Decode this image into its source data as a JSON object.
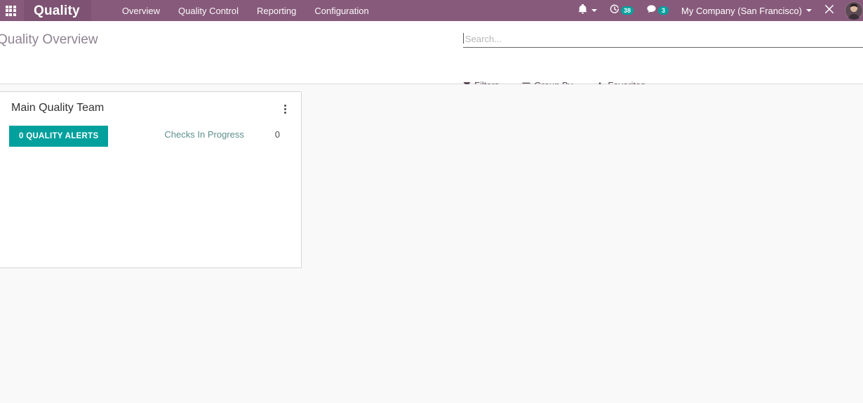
{
  "navbar": {
    "apps_icon": "apps-grid-icon",
    "brand": "Quality",
    "menu": [
      {
        "label": "Overview"
      },
      {
        "label": "Quality Control"
      },
      {
        "label": "Reporting"
      },
      {
        "label": "Configuration"
      }
    ],
    "systray": {
      "activities_icon": "clock-icon",
      "activities_count": "38",
      "messages_icon": "chat-bubble-icon",
      "messages_count": "3",
      "bell_icon": "bell-icon",
      "company": "My Company (San Francisco)",
      "debug_icon": "wrench-tools-icon",
      "avatar_icon": "user-avatar"
    },
    "colors": {
      "navbar_bg": "#875A7B",
      "brand_bg": "#7d5272",
      "badge_bg": "#00A09D"
    }
  },
  "control_panel": {
    "breadcrumb": "Quality Overview",
    "search": {
      "placeholder": "Search...",
      "value": ""
    },
    "facets": [
      {
        "label": "Filters",
        "icon": "filter-funnel-icon"
      },
      {
        "label": "Group By",
        "icon": "hamburger-lines-icon"
      },
      {
        "label": "Favorites",
        "icon": "star-icon"
      }
    ]
  },
  "main": {
    "cards": [
      {
        "title": "Main Quality Team",
        "menu_icon": "vertical-ellipsis-icon",
        "alerts_button": "0 QUALITY ALERTS",
        "stats": [
          {
            "label": "Checks In Progress",
            "value": "0"
          }
        ]
      }
    ]
  },
  "colors": {
    "accent_teal": "#00A09D",
    "page_bg": "#f9f9f9",
    "card_bg": "#ffffff",
    "link_teal": "#5e8f8c"
  }
}
